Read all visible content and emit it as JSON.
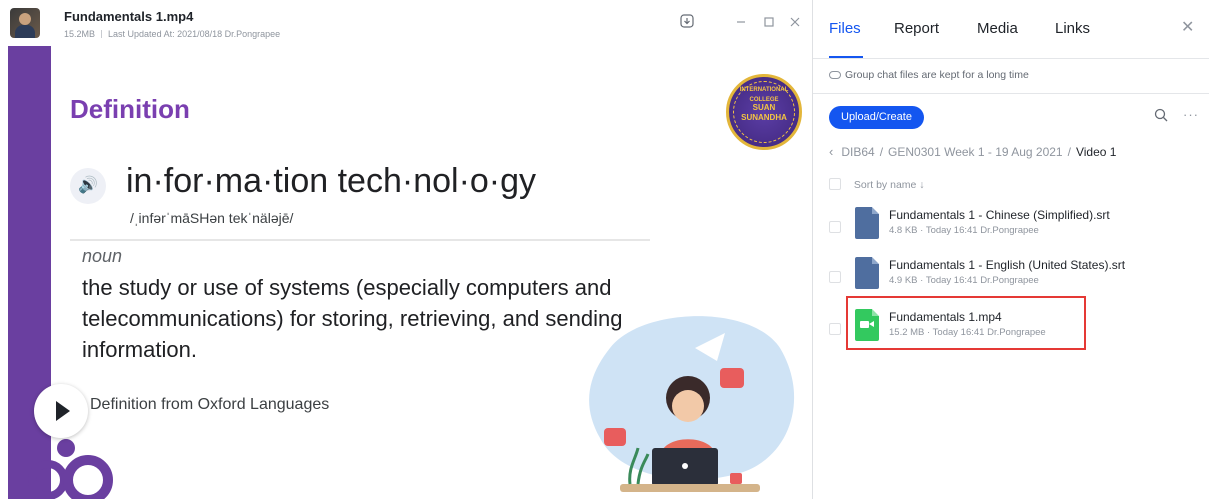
{
  "viewer": {
    "file_title": "Fundamentals 1.mp4",
    "file_size": "15.2MB",
    "last_updated": "Last Updated At: 2021/08/18 Dr.Pongrapee",
    "window_controls": [
      "download-icon",
      "minimize-icon",
      "maximize-icon",
      "close-icon"
    ]
  },
  "slide": {
    "title": "Definition",
    "seal_text_top": "INTERNATIONAL COLLEGE",
    "seal_text_mid": "SUAN\nSUNANDHA",
    "word": "in·for·ma·tion tech·nol·o·gy",
    "pronunciation": "/ˌinfərˈmāSHən tekˈnäləjē/",
    "part_of_speech": "noun",
    "definition": "the study or use of systems (especially computers and telecommunications) for storing, retrieving, and sending information.",
    "source": "Definition from Oxford Languages",
    "accent_color": "#7a3fb0",
    "bar_color": "#6a3fa0"
  },
  "panel": {
    "tabs": [
      {
        "label": "Files",
        "active": true
      },
      {
        "label": "Report",
        "active": false
      },
      {
        "label": "Media",
        "active": false
      },
      {
        "label": "Links",
        "active": false
      }
    ],
    "notice": "Group chat files are kept for a long time",
    "upload_label": "Upload/Create",
    "breadcrumb": [
      "DIB64",
      "GEN0301 Week 1 - 19 Aug 2021",
      "Video 1"
    ],
    "sort_label": "Sort by name ↓",
    "files": [
      {
        "name": "Fundamentals 1 - Chinese (Simplified).srt",
        "size": "4.8 KB",
        "time": "Today 16:41",
        "owner": "Dr.Pongrapee",
        "type": "srt"
      },
      {
        "name": "Fundamentals 1 - English (United States).srt",
        "size": "4.9 KB",
        "time": "Today 16:41",
        "owner": "Dr.Pongrapee",
        "type": "srt"
      },
      {
        "name": "Fundamentals 1.mp4",
        "size": "15.2 MB",
        "time": "Today 16:41",
        "owner": "Dr.Pongrapee",
        "type": "mp4",
        "highlighted": true
      }
    ],
    "accent_color": "#1456f0",
    "highlight_color": "#e53935"
  }
}
